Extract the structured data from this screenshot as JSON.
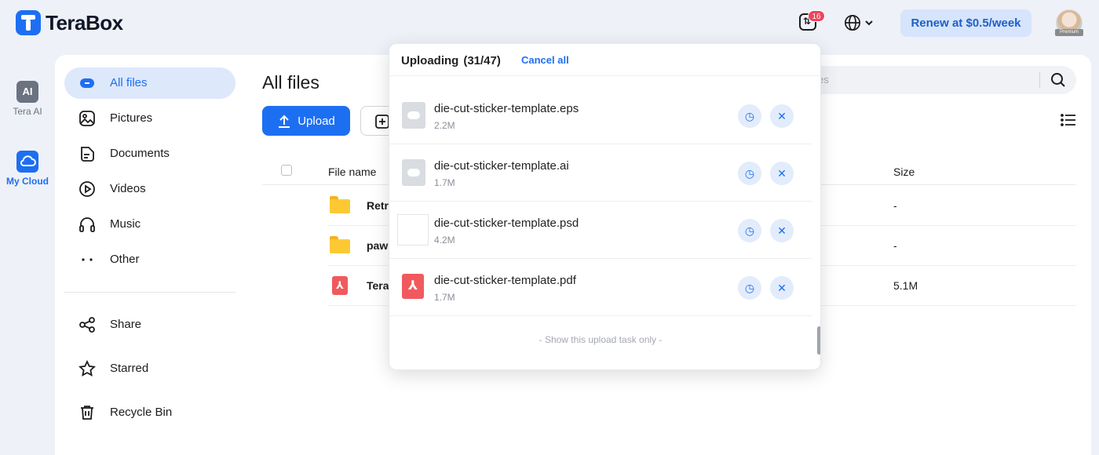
{
  "app": {
    "name": "TeraBox"
  },
  "header": {
    "transfer_badge": "16",
    "renew_label": "Renew at $0.5/week",
    "avatar_tag": "Premium"
  },
  "rail": [
    {
      "label": "Tera AI",
      "icon": "ai-icon"
    },
    {
      "label": "My Cloud",
      "icon": "cloud-icon",
      "active": true
    }
  ],
  "sidebar": {
    "items": [
      {
        "label": "All files",
        "icon": "all-files-icon",
        "active": true
      },
      {
        "label": "Pictures",
        "icon": "pictures-icon"
      },
      {
        "label": "Documents",
        "icon": "documents-icon"
      },
      {
        "label": "Videos",
        "icon": "videos-icon"
      },
      {
        "label": "Music",
        "icon": "music-icon"
      },
      {
        "label": "Other",
        "icon": "other-icon"
      }
    ],
    "bottom_items": [
      {
        "label": "Share",
        "icon": "share-icon"
      },
      {
        "label": "Starred",
        "icon": "star-icon"
      },
      {
        "label": "Recycle Bin",
        "icon": "trash-icon"
      }
    ]
  },
  "main": {
    "title": "All files",
    "upload_label": "Upload",
    "search_placeholder_visible": "es",
    "columns": {
      "name": "File name",
      "size": "Size"
    },
    "rows": [
      {
        "name": "Retr",
        "type": "folder",
        "size": "-"
      },
      {
        "name": "paw",
        "type": "folder",
        "size": "-"
      },
      {
        "name": "Tera",
        "type": "pdf",
        "size": "5.1M"
      }
    ]
  },
  "popup": {
    "title": "Uploading",
    "count": "(31/47)",
    "cancel_all": "Cancel all",
    "items": [
      {
        "name": "die-cut-sticker-template.eps",
        "size": "2.2M",
        "icon": "cloud-file-icon"
      },
      {
        "name": "die-cut-sticker-template.ai",
        "size": "1.7M",
        "icon": "cloud-file-icon"
      },
      {
        "name": "die-cut-sticker-template.psd",
        "size": "4.2M",
        "icon": "blank-file-icon"
      },
      {
        "name": "die-cut-sticker-template.pdf",
        "size": "1.7M",
        "icon": "pdf-file-icon"
      }
    ],
    "footer": "- Show this upload task only -"
  },
  "colors": {
    "accent": "#1d6ff2",
    "background": "#eef1f8",
    "badge": "#f0435b",
    "active_nav_bg": "#dde8fb"
  }
}
